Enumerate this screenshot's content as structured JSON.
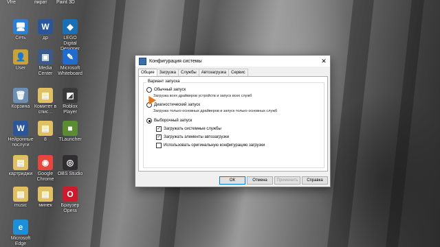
{
  "top_labels": [
    "Vfre",
    "пират",
    "Paint 3D"
  ],
  "desktop_icons": [
    {
      "label": "Сеть",
      "icon": "network-icon",
      "color": "#2b7fd4",
      "glyph": "🖥"
    },
    {
      "label": "др",
      "icon": "word-doc-icon",
      "color": "#2b579a",
      "glyph": "W"
    },
    {
      "label": "LEGO Digital Designer",
      "icon": "lego-icon",
      "color": "#1a6fb5",
      "glyph": "◆"
    },
    {
      "label": "User",
      "icon": "user-folder-icon",
      "color": "#c8a23a",
      "glyph": "👤"
    },
    {
      "label": "Media Center",
      "icon": "media-center-icon",
      "color": "#3c5a8a",
      "glyph": "▣"
    },
    {
      "label": "Microsoft Whiteboard",
      "icon": "whiteboard-icon",
      "color": "#1f6bcf",
      "glyph": "✎"
    },
    {
      "label": "Корзина",
      "icon": "recycle-bin-icon",
      "color": "#6d8fb5",
      "glyph": "🗑"
    },
    {
      "label": "Комитет в спис...",
      "icon": "folder-icon",
      "color": "#e0c060",
      "glyph": "▤"
    },
    {
      "label": "Roblox Player",
      "icon": "roblox-icon",
      "color": "#3a3a3a",
      "glyph": "◩"
    },
    {
      "label": "Нейронные послуги",
      "icon": "word-doc-icon",
      "color": "#2b579a",
      "glyph": "W"
    },
    {
      "label": "8",
      "icon": "folder-icon",
      "color": "#e0c060",
      "glyph": "▤"
    },
    {
      "label": "TLauncher",
      "icon": "tlauncher-icon",
      "color": "#5b8c2f",
      "glyph": "■"
    },
    {
      "label": "картриджи",
      "icon": "folder-icon",
      "color": "#e0c060",
      "glyph": "▤"
    },
    {
      "label": "Google Chrome",
      "icon": "chrome-icon",
      "color": "#e8453c",
      "glyph": "◉"
    },
    {
      "label": "OBS Studio",
      "icon": "obs-icon",
      "color": "#302e31",
      "glyph": "◎"
    },
    {
      "label": "music",
      "icon": "folder-icon",
      "color": "#e0c060",
      "glyph": "▤"
    },
    {
      "label": "минек",
      "icon": "folder-icon",
      "color": "#e0c060",
      "glyph": "▤"
    },
    {
      "label": "Браузер Opera",
      "icon": "opera-icon",
      "color": "#cc1b2f",
      "glyph": "O"
    },
    {
      "label": "Microsoft Edge",
      "icon": "edge-icon",
      "color": "#1d8fd8",
      "glyph": "e"
    }
  ],
  "dialog": {
    "title": "Конфигурация системы",
    "tabs": [
      "Общие",
      "Загрузка",
      "Службы",
      "Автозагрузка",
      "Сервис"
    ],
    "active_tab": 0,
    "group_label": "Вариант запуска",
    "options": [
      {
        "label": "Обычный запуск",
        "desc": "Загрузка всех драйверов устройств и запуск всех служб",
        "selected": false
      },
      {
        "label": "Диагностический запуск",
        "desc": "Загрузка только основных драйверов и запуск только основных служб",
        "selected": false
      },
      {
        "label": "Выборочный запуск",
        "selected": true
      }
    ],
    "checkboxes": [
      {
        "label": "Загружать системные службы",
        "checked": true
      },
      {
        "label": "Загружать элементы автозагрузки",
        "checked": true
      },
      {
        "label": "Использовать оригинальную конфигурацию загрузки",
        "checked": false
      }
    ],
    "buttons": {
      "ok": "ОК",
      "cancel": "Отмена",
      "apply": "Применить",
      "help": "Справка"
    },
    "close_glyph": "✕",
    "check_glyph": "✓"
  }
}
